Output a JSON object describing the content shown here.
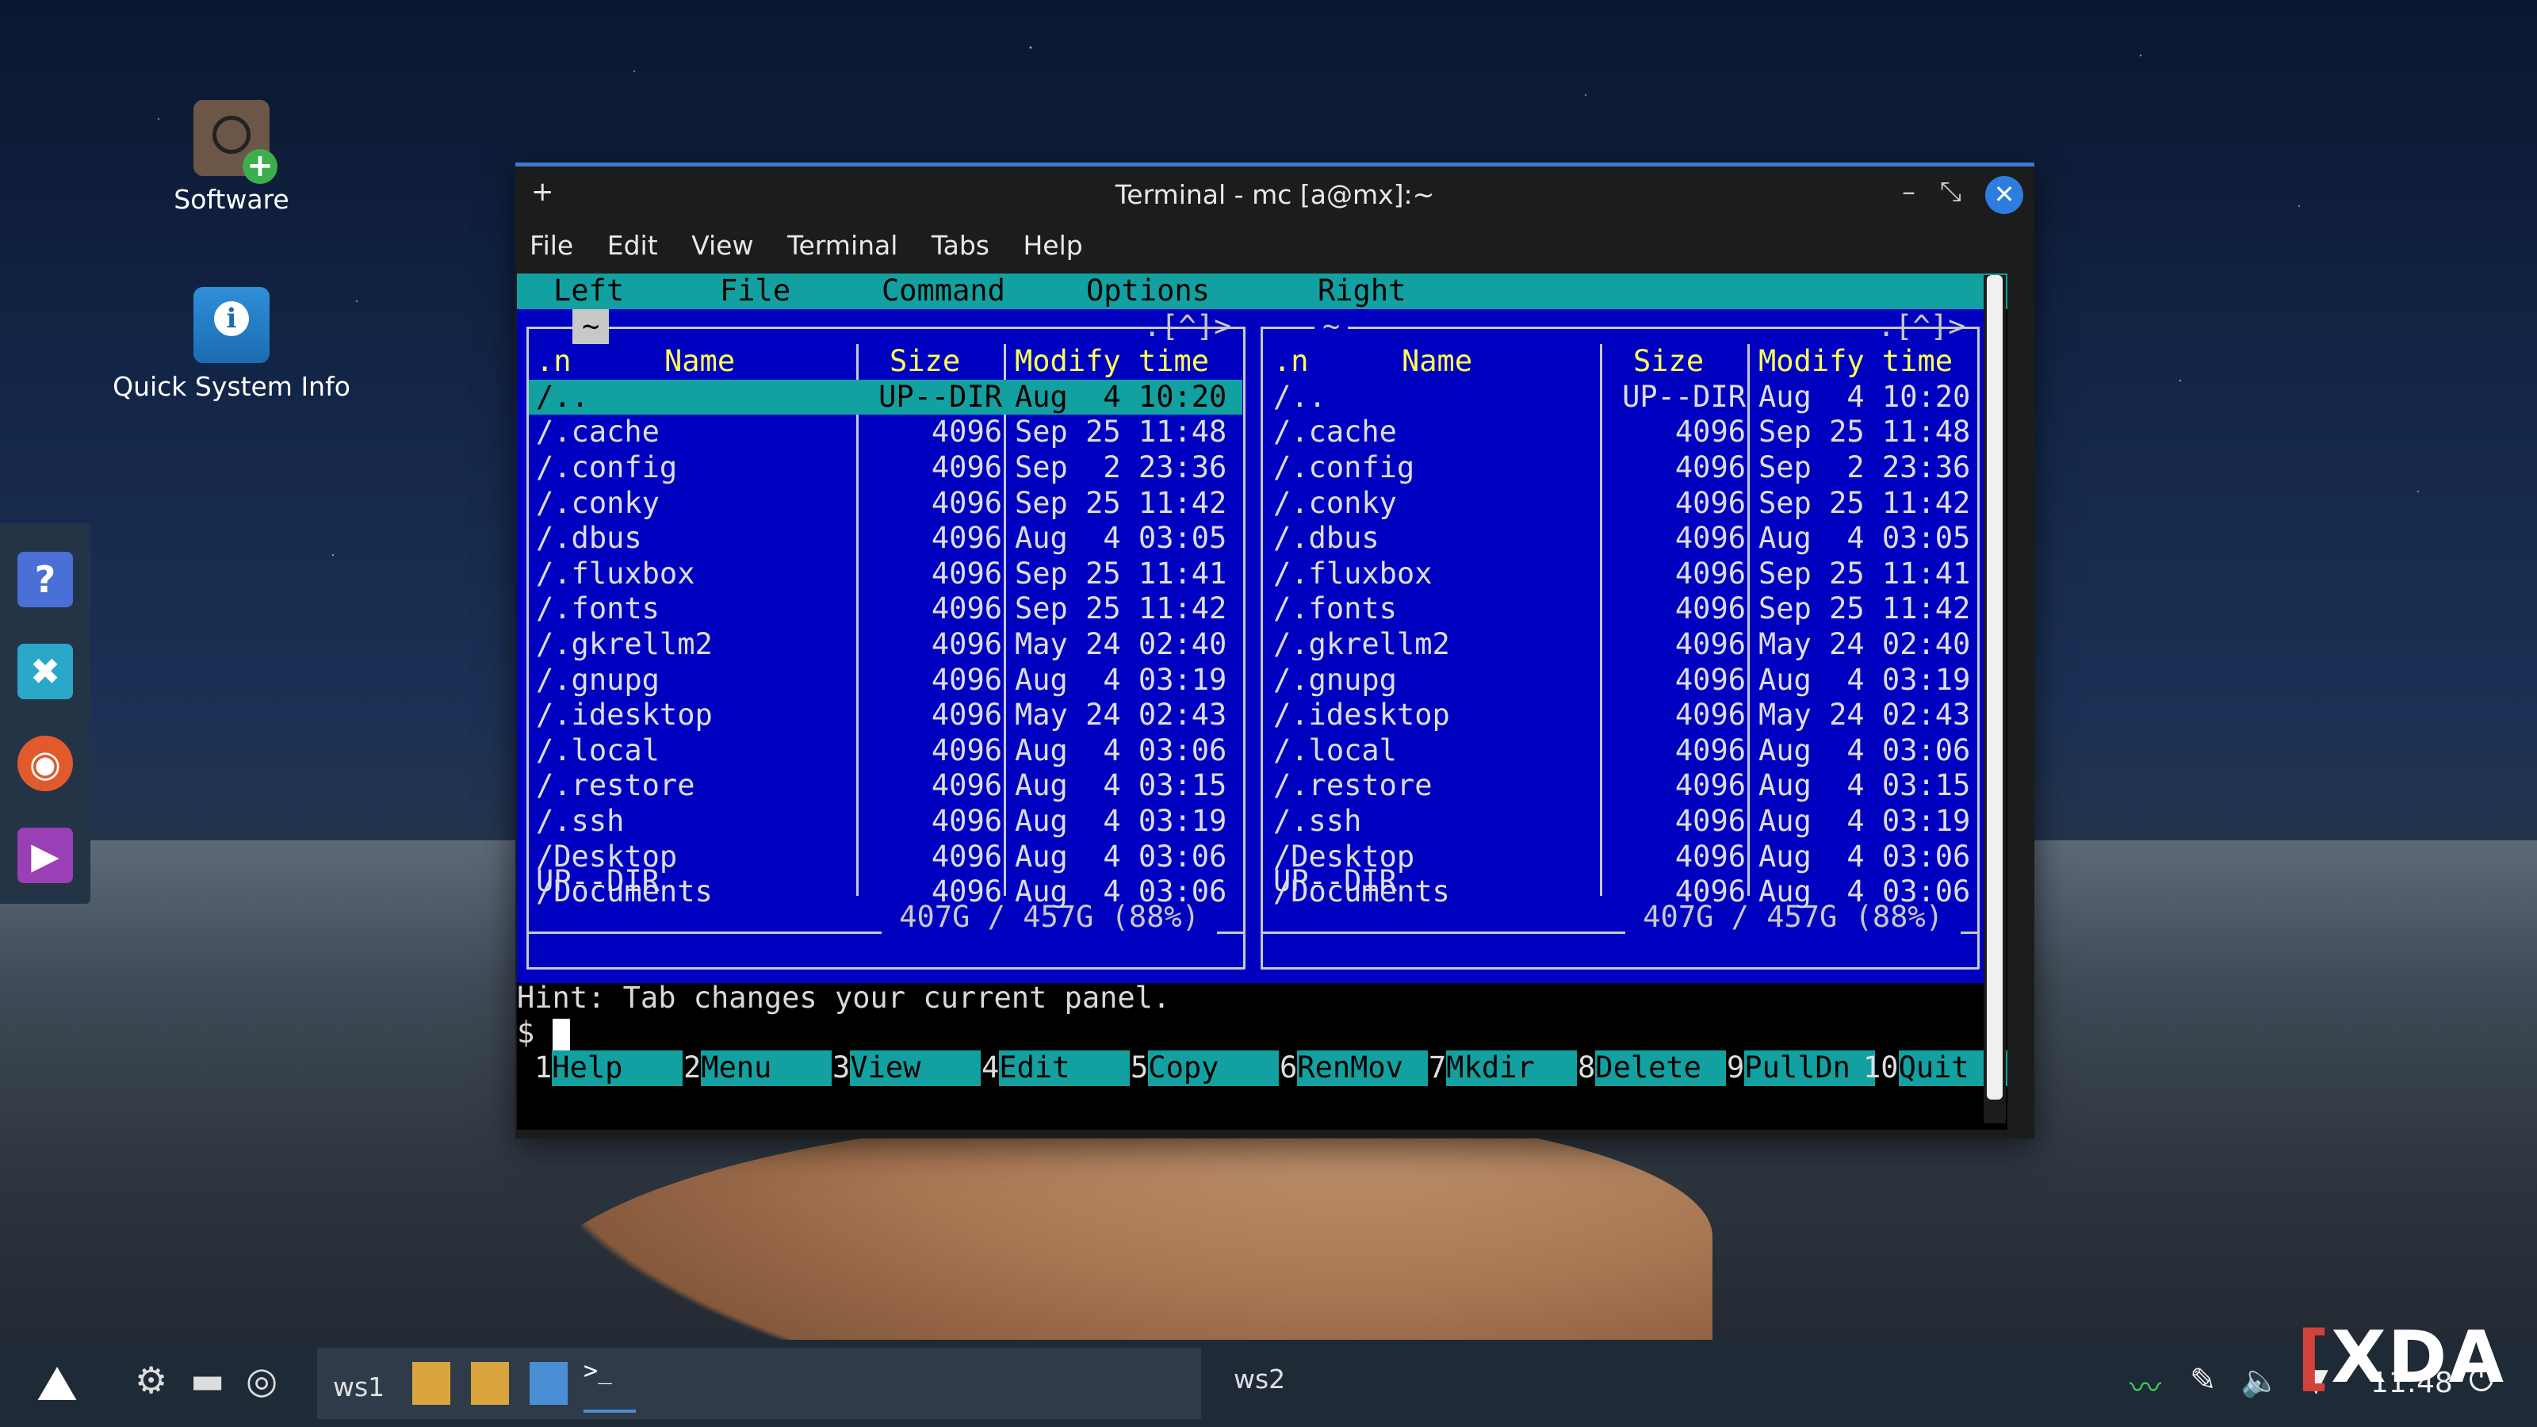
{
  "desktop": {
    "icons": [
      {
        "label": "Software",
        "icon": "software-install-icon"
      },
      {
        "label": "Quick System Info",
        "icon": "info-icon"
      }
    ],
    "dock": [
      {
        "icon": "help-icon",
        "glyph": "?"
      },
      {
        "icon": "tools-icon",
        "glyph": "✖"
      },
      {
        "icon": "rss-settings-icon",
        "glyph": "◉"
      },
      {
        "icon": "media-player-icon",
        "glyph": "▶"
      }
    ]
  },
  "window": {
    "title": "Terminal - mc [a@mx]:~",
    "pin_glyph": "+",
    "minimize_glyph": "–",
    "maximize_glyph": "⤡",
    "close_glyph": "✕",
    "menu": [
      "File",
      "Edit",
      "View",
      "Terminal",
      "Tabs",
      "Help"
    ]
  },
  "mc": {
    "top_menu": [
      "Left",
      "File",
      "Command",
      "Options",
      "Right"
    ],
    "left_panel": {
      "path": "~",
      "corner": ".[^]>",
      "headers": {
        "n": ".n",
        "name": "Name",
        "size": "Size",
        "mtime": "Modify time"
      },
      "rows": [
        {
          "name": "/..",
          "size": "UP--DIR",
          "mtime": "Aug  4 10:20"
        },
        {
          "name": "/.cache",
          "size": "4096",
          "mtime": "Sep 25 11:48"
        },
        {
          "name": "/.config",
          "size": "4096",
          "mtime": "Sep  2 23:36"
        },
        {
          "name": "/.conky",
          "size": "4096",
          "mtime": "Sep 25 11:42"
        },
        {
          "name": "/.dbus",
          "size": "4096",
          "mtime": "Aug  4 03:05"
        },
        {
          "name": "/.fluxbox",
          "size": "4096",
          "mtime": "Sep 25 11:41"
        },
        {
          "name": "/.fonts",
          "size": "4096",
          "mtime": "Sep 25 11:42"
        },
        {
          "name": "/.gkrellm2",
          "size": "4096",
          "mtime": "May 24 02:40"
        },
        {
          "name": "/.gnupg",
          "size": "4096",
          "mtime": "Aug  4 03:19"
        },
        {
          "name": "/.idesktop",
          "size": "4096",
          "mtime": "May 24 02:43"
        },
        {
          "name": "/.local",
          "size": "4096",
          "mtime": "Aug  4 03:06"
        },
        {
          "name": "/.restore",
          "size": "4096",
          "mtime": "Aug  4 03:15"
        },
        {
          "name": "/.ssh",
          "size": "4096",
          "mtime": "Aug  4 03:19"
        },
        {
          "name": "/Desktop",
          "size": "4096",
          "mtime": "Aug  4 03:06"
        },
        {
          "name": "/Documents",
          "size": "4096",
          "mtime": "Aug  4 03:06"
        }
      ],
      "status": "UP--DIR",
      "disk": " 407G / 457G (88%) "
    },
    "right_panel": {
      "path": "~",
      "corner": ".[^]>",
      "headers": {
        "n": ".n",
        "name": "Name",
        "size": "Size",
        "mtime": "Modify time"
      },
      "rows": [
        {
          "name": "/..",
          "size": "UP--DIR",
          "mtime": "Aug  4 10:20"
        },
        {
          "name": "/.cache",
          "size": "4096",
          "mtime": "Sep 25 11:48"
        },
        {
          "name": "/.config",
          "size": "4096",
          "mtime": "Sep  2 23:36"
        },
        {
          "name": "/.conky",
          "size": "4096",
          "mtime": "Sep 25 11:42"
        },
        {
          "name": "/.dbus",
          "size": "4096",
          "mtime": "Aug  4 03:05"
        },
        {
          "name": "/.fluxbox",
          "size": "4096",
          "mtime": "Sep 25 11:41"
        },
        {
          "name": "/.fonts",
          "size": "4096",
          "mtime": "Sep 25 11:42"
        },
        {
          "name": "/.gkrellm2",
          "size": "4096",
          "mtime": "May 24 02:40"
        },
        {
          "name": "/.gnupg",
          "size": "4096",
          "mtime": "Aug  4 03:19"
        },
        {
          "name": "/.idesktop",
          "size": "4096",
          "mtime": "May 24 02:43"
        },
        {
          "name": "/.local",
          "size": "4096",
          "mtime": "Aug  4 03:06"
        },
        {
          "name": "/.restore",
          "size": "4096",
          "mtime": "Aug  4 03:15"
        },
        {
          "name": "/.ssh",
          "size": "4096",
          "mtime": "Aug  4 03:19"
        },
        {
          "name": "/Desktop",
          "size": "4096",
          "mtime": "Aug  4 03:06"
        },
        {
          "name": "/Documents",
          "size": "4096",
          "mtime": "Aug  4 03:06"
        }
      ],
      "status": "UP--DIR",
      "disk": " 407G / 457G (88%) "
    },
    "hint": "Hint: Tab changes your current panel.",
    "prompt": "$",
    "fkeys": [
      {
        "num": "1",
        "label": "Help"
      },
      {
        "num": "2",
        "label": "Menu"
      },
      {
        "num": "3",
        "label": "View"
      },
      {
        "num": "4",
        "label": "Edit"
      },
      {
        "num": "5",
        "label": "Copy"
      },
      {
        "num": "6",
        "label": "RenMov"
      },
      {
        "num": "7",
        "label": "Mkdir"
      },
      {
        "num": "8",
        "label": "Delete"
      },
      {
        "num": "9",
        "label": "PullDn"
      },
      {
        "num": "10",
        "label": "Quit"
      }
    ]
  },
  "taskbar": {
    "workspace1": "ws1",
    "workspace2": "ws2",
    "clock": "11:48",
    "watermark": "XDA"
  },
  "colors": {
    "panel_bg": "#0000c0",
    "accent_cyan": "#13a0a0",
    "header_yellow": "#ffff55",
    "window_border": "#3b79d6"
  }
}
